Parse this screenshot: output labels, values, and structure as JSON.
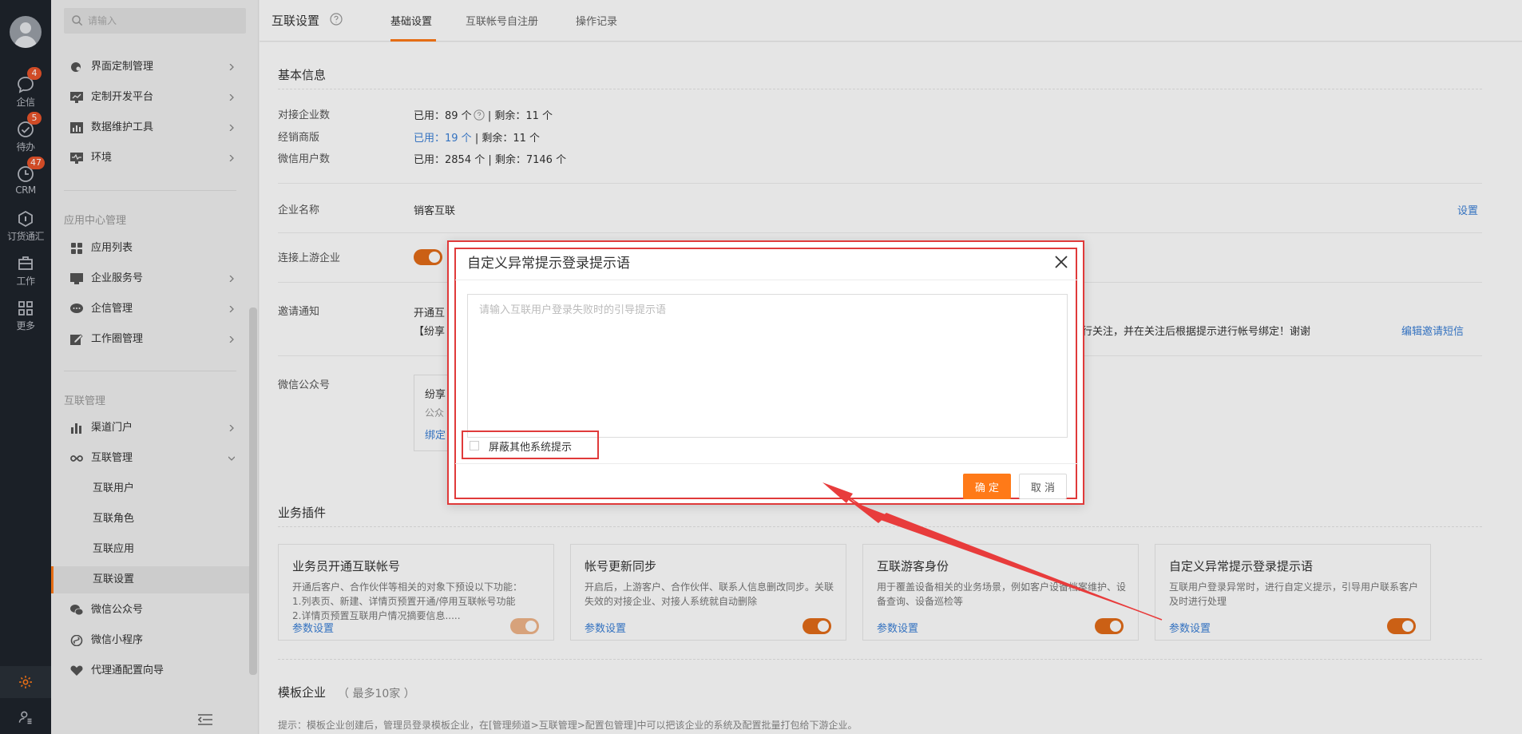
{
  "rail": {
    "items": [
      {
        "label": "企信",
        "badge": "4",
        "icon": "chat-bubble-icon"
      },
      {
        "label": "待办",
        "badge": "5",
        "icon": "check-circle-icon"
      },
      {
        "label": "CRM",
        "badge": "47",
        "icon": "crm-clock-icon"
      },
      {
        "label": "订货通汇",
        "badge": "",
        "icon": "order-box-icon"
      },
      {
        "label": "工作",
        "badge": "",
        "icon": "briefcase-icon"
      },
      {
        "label": "更多",
        "badge": "",
        "icon": "grid-apps-icon"
      }
    ]
  },
  "menu": {
    "search_placeholder": "请输入",
    "top_items": [
      {
        "label": "界面定制管理"
      },
      {
        "label": "定制开发平台"
      },
      {
        "label": "数据维护工具"
      },
      {
        "label": "环境"
      }
    ],
    "section_app": "应用中心管理",
    "app_items": [
      {
        "label": "应用列表"
      },
      {
        "label": "企业服务号"
      },
      {
        "label": "企信管理"
      },
      {
        "label": "工作圈管理"
      }
    ],
    "section_interconnect": "互联管理",
    "ic_items": [
      {
        "label": "渠道门户"
      },
      {
        "label": "互联管理"
      }
    ],
    "sub_items": [
      {
        "label": "互联用户"
      },
      {
        "label": "互联角色"
      },
      {
        "label": "互联应用"
      },
      {
        "label": "互联设置"
      }
    ],
    "bottom_items": [
      {
        "label": "微信公众号"
      },
      {
        "label": "微信小程序"
      },
      {
        "label": "代理通配置向导"
      }
    ]
  },
  "topbar": {
    "title": "互联设置",
    "tabs": [
      "基础设置",
      "互联帐号自注册",
      "操作记录"
    ]
  },
  "basic": {
    "section_title": "基本信息",
    "partner_label": "对接企业数",
    "partner_used": "已用：89 个",
    "partner_rest": " | 剩余：11 个",
    "dealer_label": "经销商版",
    "dealer_used": "已用：19 个",
    "dealer_rest": " | 剩余：11 个",
    "wechat_label": "微信用户数",
    "wechat_value": "已用：2854 个 | 剩余：7146 个",
    "company_label": "企业名称",
    "company_value": "销客互联",
    "company_action": "设置",
    "upstream_label": "连接上游企业",
    "invite_label": "邀请通知",
    "invite_line1": "开通互",
    "invite_line2": "【纷享",
    "invite_tail": "行关注，并在关注后根据提示进行帐号绑定！谢谢",
    "invite_action": "编辑邀请短信",
    "mp_label": "微信公众号",
    "mp_line1": "纷享",
    "mp_line2": "公众",
    "mp_line3": "绑定"
  },
  "plugins": {
    "section_title": "业务插件",
    "cards": [
      {
        "title": "业务员开通互联帐号",
        "desc": "开通后客户、合作伙伴等相关的对象下预设以下功能：\n1.列表页、新建、详情页预置开通/停用互联帐号功能\n2.详情页预置互联用户情况摘要信息.....",
        "link": "参数设置",
        "on": true,
        "dim": true
      },
      {
        "title": "帐号更新同步",
        "desc": "开启后，上游客户、合作伙伴、联系人信息删改同步。关联失效的对接企业、对接人系统就自动删除",
        "link": "参数设置",
        "on": true,
        "dim": false
      },
      {
        "title": "互联游客身份",
        "desc": "用于覆盖设备相关的业务场景，例如客户设备档案维护、设备查询、设备巡检等",
        "link": "参数设置",
        "on": true,
        "dim": false
      },
      {
        "title": "自定义异常提示登录提示语",
        "desc": "互联用户登录异常时，进行自定义提示，引导用户联系客户及时进行处理",
        "link": "参数设置",
        "on": true,
        "dim": false
      }
    ]
  },
  "template": {
    "title": "模板企业",
    "subtitle": "（ 最多10家 ）",
    "note": "提示：模板企业创建后，管理员登录模板企业，在[管理频道>互联管理>配置包管理]中可以把该企业的系统及配置批量打包给下游企业。"
  },
  "modal": {
    "title": "自定义异常提示登录提示语",
    "textarea_placeholder": "请输入互联用户登录失败时的引导提示语",
    "checkbox_label": "屏蔽其他系统提示",
    "ok_label": "确 定",
    "cancel_label": "取 消"
  },
  "colors": {
    "accent": "#ff7a18",
    "link": "#3a7fd6",
    "highlight": "#e03a3a",
    "rail_bg": "#1f242c"
  }
}
